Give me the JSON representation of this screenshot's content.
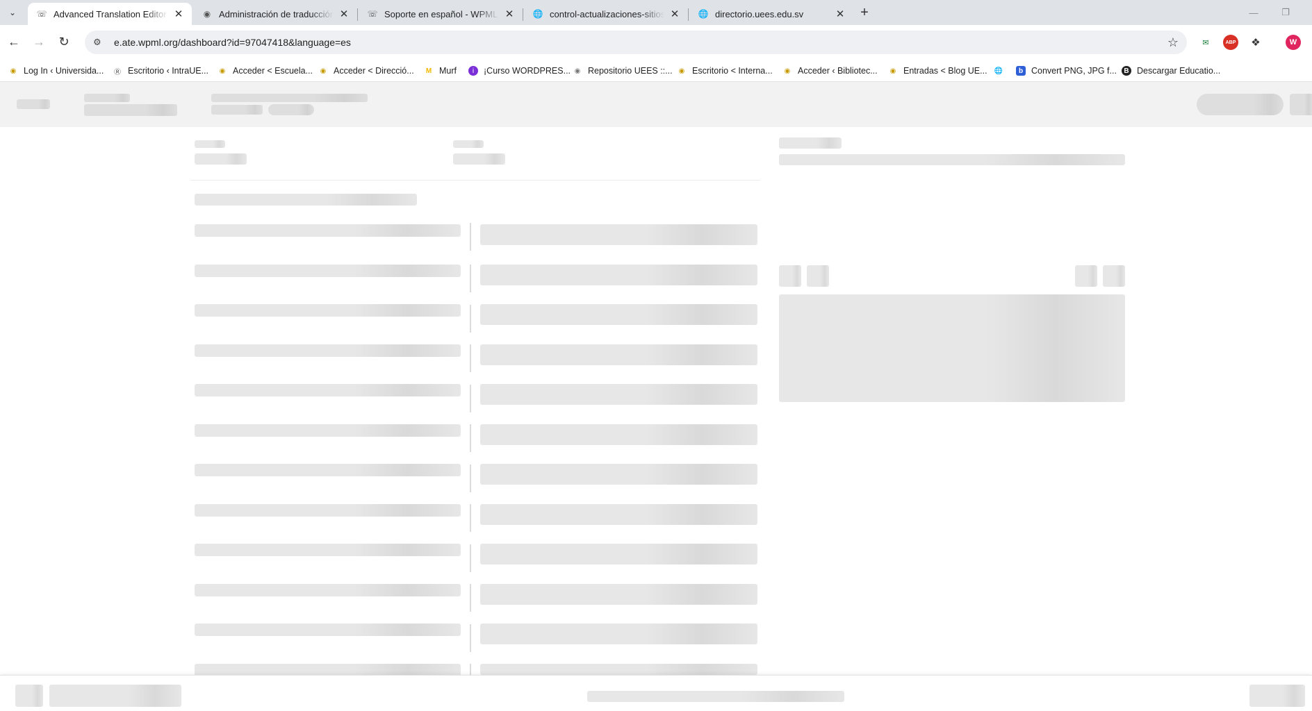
{
  "browser": {
    "tabs": [
      {
        "title": "Advanced Translation Editor - ",
        "favicon": "headset-icon",
        "active": true
      },
      {
        "title": "Administración de traducción",
        "favicon": "site-logo-icon",
        "active": false
      },
      {
        "title": "Soporte en español - WPML",
        "favicon": "headset-icon",
        "active": false
      },
      {
        "title": "control-actualizaciones-sitios",
        "favicon": "globe-icon",
        "active": false
      },
      {
        "title": "directorio.uees.edu.sv",
        "favicon": "globe-icon",
        "active": false
      }
    ],
    "address_bar": {
      "url": "e.ate.wpml.org/dashboard?id=97047418&language=es"
    },
    "profile_initial": "W",
    "bookmarks": [
      {
        "label": "Log In ‹ Universida...",
        "icon": "site-logo-icon"
      },
      {
        "label": "Escritorio ‹ IntraUE...",
        "icon": "wordpress-icon"
      },
      {
        "label": "Acceder < Escuela...",
        "icon": "site-logo-icon"
      },
      {
        "label": "Acceder < Direcció...",
        "icon": "site-logo-icon"
      },
      {
        "label": "Murf",
        "icon": "murf-icon"
      },
      {
        "label": "¡Curso WORDPRES...",
        "icon": "course-icon"
      },
      {
        "label": "Repositorio UEES ::...",
        "icon": "site-logo-icon"
      },
      {
        "label": "Escritorio < Interna...",
        "icon": "site-logo-icon"
      },
      {
        "label": "Acceder ‹ Bibliotec...",
        "icon": "site-logo-icon"
      },
      {
        "label": "Entradas < Blog UE...",
        "icon": "site-logo-icon"
      },
      {
        "label": "",
        "icon": "globe-icon"
      },
      {
        "label": "Convert PNG, JPG f...",
        "icon": "convert-icon"
      },
      {
        "label": "Descargar Educatio...",
        "icon": "educatio-icon"
      }
    ]
  },
  "colors": {
    "tabstrip": "#dfe3e8",
    "skeleton": "#e7e7e7",
    "header_bg": "#f2f2f2",
    "profile": "#e0245e"
  }
}
